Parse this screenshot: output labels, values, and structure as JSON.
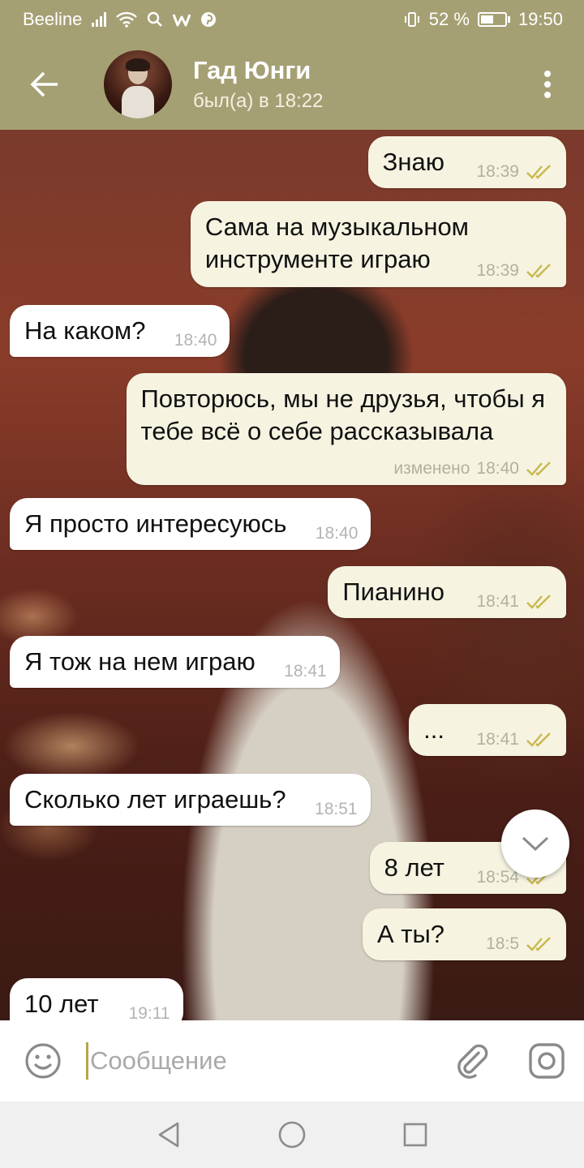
{
  "status_bar": {
    "carrier": "Beeline",
    "battery_text": "52 %",
    "battery_level": 0.52,
    "time": "19:50",
    "icons": [
      "signal-icon",
      "wifi-icon",
      "search-icon",
      "w-app-icon",
      "pinterest-icon",
      "vibrate-icon",
      "battery-icon"
    ]
  },
  "header": {
    "back_icon": "arrow-left-icon",
    "contact_name": "Гад Юнги",
    "last_seen": "был(а) в 18:22",
    "menu_icon": "more-vert-icon"
  },
  "messages": [
    {
      "direction": "out",
      "text": "Знаю",
      "time": "18:39",
      "edited_label": "",
      "read": true
    },
    {
      "direction": "out",
      "text": "Сама на музыкальном\nинструменте играю",
      "time": "18:39",
      "edited_label": "",
      "read": true
    },
    {
      "direction": "in",
      "text": "На каком?",
      "time": "18:40",
      "edited_label": ""
    },
    {
      "direction": "out",
      "text": "Повторюсь, мы не друзья, чтобы я\nтебе всё о себе рассказывала",
      "time": "18:40",
      "edited_label": "изменено",
      "read": true
    },
    {
      "direction": "in",
      "text": "Я просто интересуюсь",
      "time": "18:40",
      "edited_label": ""
    },
    {
      "direction": "out",
      "text": "Пианино",
      "time": "18:41",
      "edited_label": "",
      "read": true
    },
    {
      "direction": "in",
      "text": "Я тож на нем играю",
      "time": "18:41",
      "edited_label": ""
    },
    {
      "direction": "out",
      "text": "...",
      "time": "18:41",
      "edited_label": "",
      "read": true
    },
    {
      "direction": "in",
      "text": "Сколько лет играешь?",
      "time": "18:51",
      "edited_label": ""
    },
    {
      "direction": "out",
      "text": "8 лет",
      "time": "18:54",
      "edited_label": "",
      "read": true
    },
    {
      "direction": "out",
      "text": "А ты?",
      "time": "18:5",
      "edited_label": "",
      "read": true
    },
    {
      "direction": "in",
      "text": "10 лет",
      "time": "19:11",
      "edited_label": ""
    }
  ],
  "scroll_down_icon": "chevron-down-icon",
  "input_bar": {
    "emoji_icon": "emoji-icon",
    "placeholder": "Сообщение",
    "attach_icon": "paperclip-icon",
    "camera_icon": "camera-icon"
  },
  "nav_bar": {
    "icons": [
      "back-triangle-icon",
      "home-circle-icon",
      "recents-square-icon"
    ]
  },
  "colors": {
    "header_bg": "#a5a074",
    "outgoing_bubble": "#f6f3e1",
    "incoming_bubble": "#ffffff",
    "read_check": "#c9b84e",
    "cursor": "#b5a64a"
  }
}
